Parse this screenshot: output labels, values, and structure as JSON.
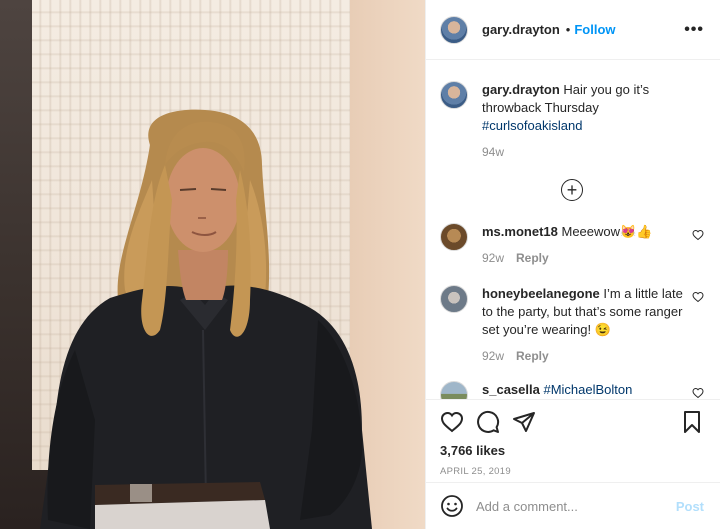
{
  "post": {
    "username": "gary.drayton",
    "separator": "•",
    "follow_label": "Follow",
    "more_label": "•••"
  },
  "caption": {
    "username": "gary.drayton",
    "text_before": " Hair you go it’s throwback Thursday ",
    "hashtag": "#curlsofoakisland",
    "age": "94w"
  },
  "load_more": {
    "label": "+"
  },
  "comments": [
    {
      "username": "ms.monet18",
      "text": " Meeewow😻👍",
      "age": "92w",
      "reply_label": "Reply"
    },
    {
      "username": "honeybeelanegone",
      "text": " I’m a little late to the party, but that’s some ranger set you’re wearing! 😉",
      "age": "92w",
      "reply_label": "Reply"
    },
    {
      "username": "s_casella",
      "text": " ",
      "hashtag": "#MichaelBolton"
    }
  ],
  "stats": {
    "likes": "3,766 likes",
    "date": "April 25, 2019"
  },
  "composer": {
    "placeholder": "Add a comment...",
    "post_label": "Post"
  },
  "colors": {
    "accent": "#0095f6",
    "hashtag": "#00376b",
    "muted": "#8e8e8e",
    "post_disabled": "#b2dffc"
  },
  "icons": [
    "heart-icon",
    "comment-icon",
    "share-icon",
    "bookmark-icon",
    "emoji-icon",
    "plus-circle-icon",
    "more-icon"
  ]
}
